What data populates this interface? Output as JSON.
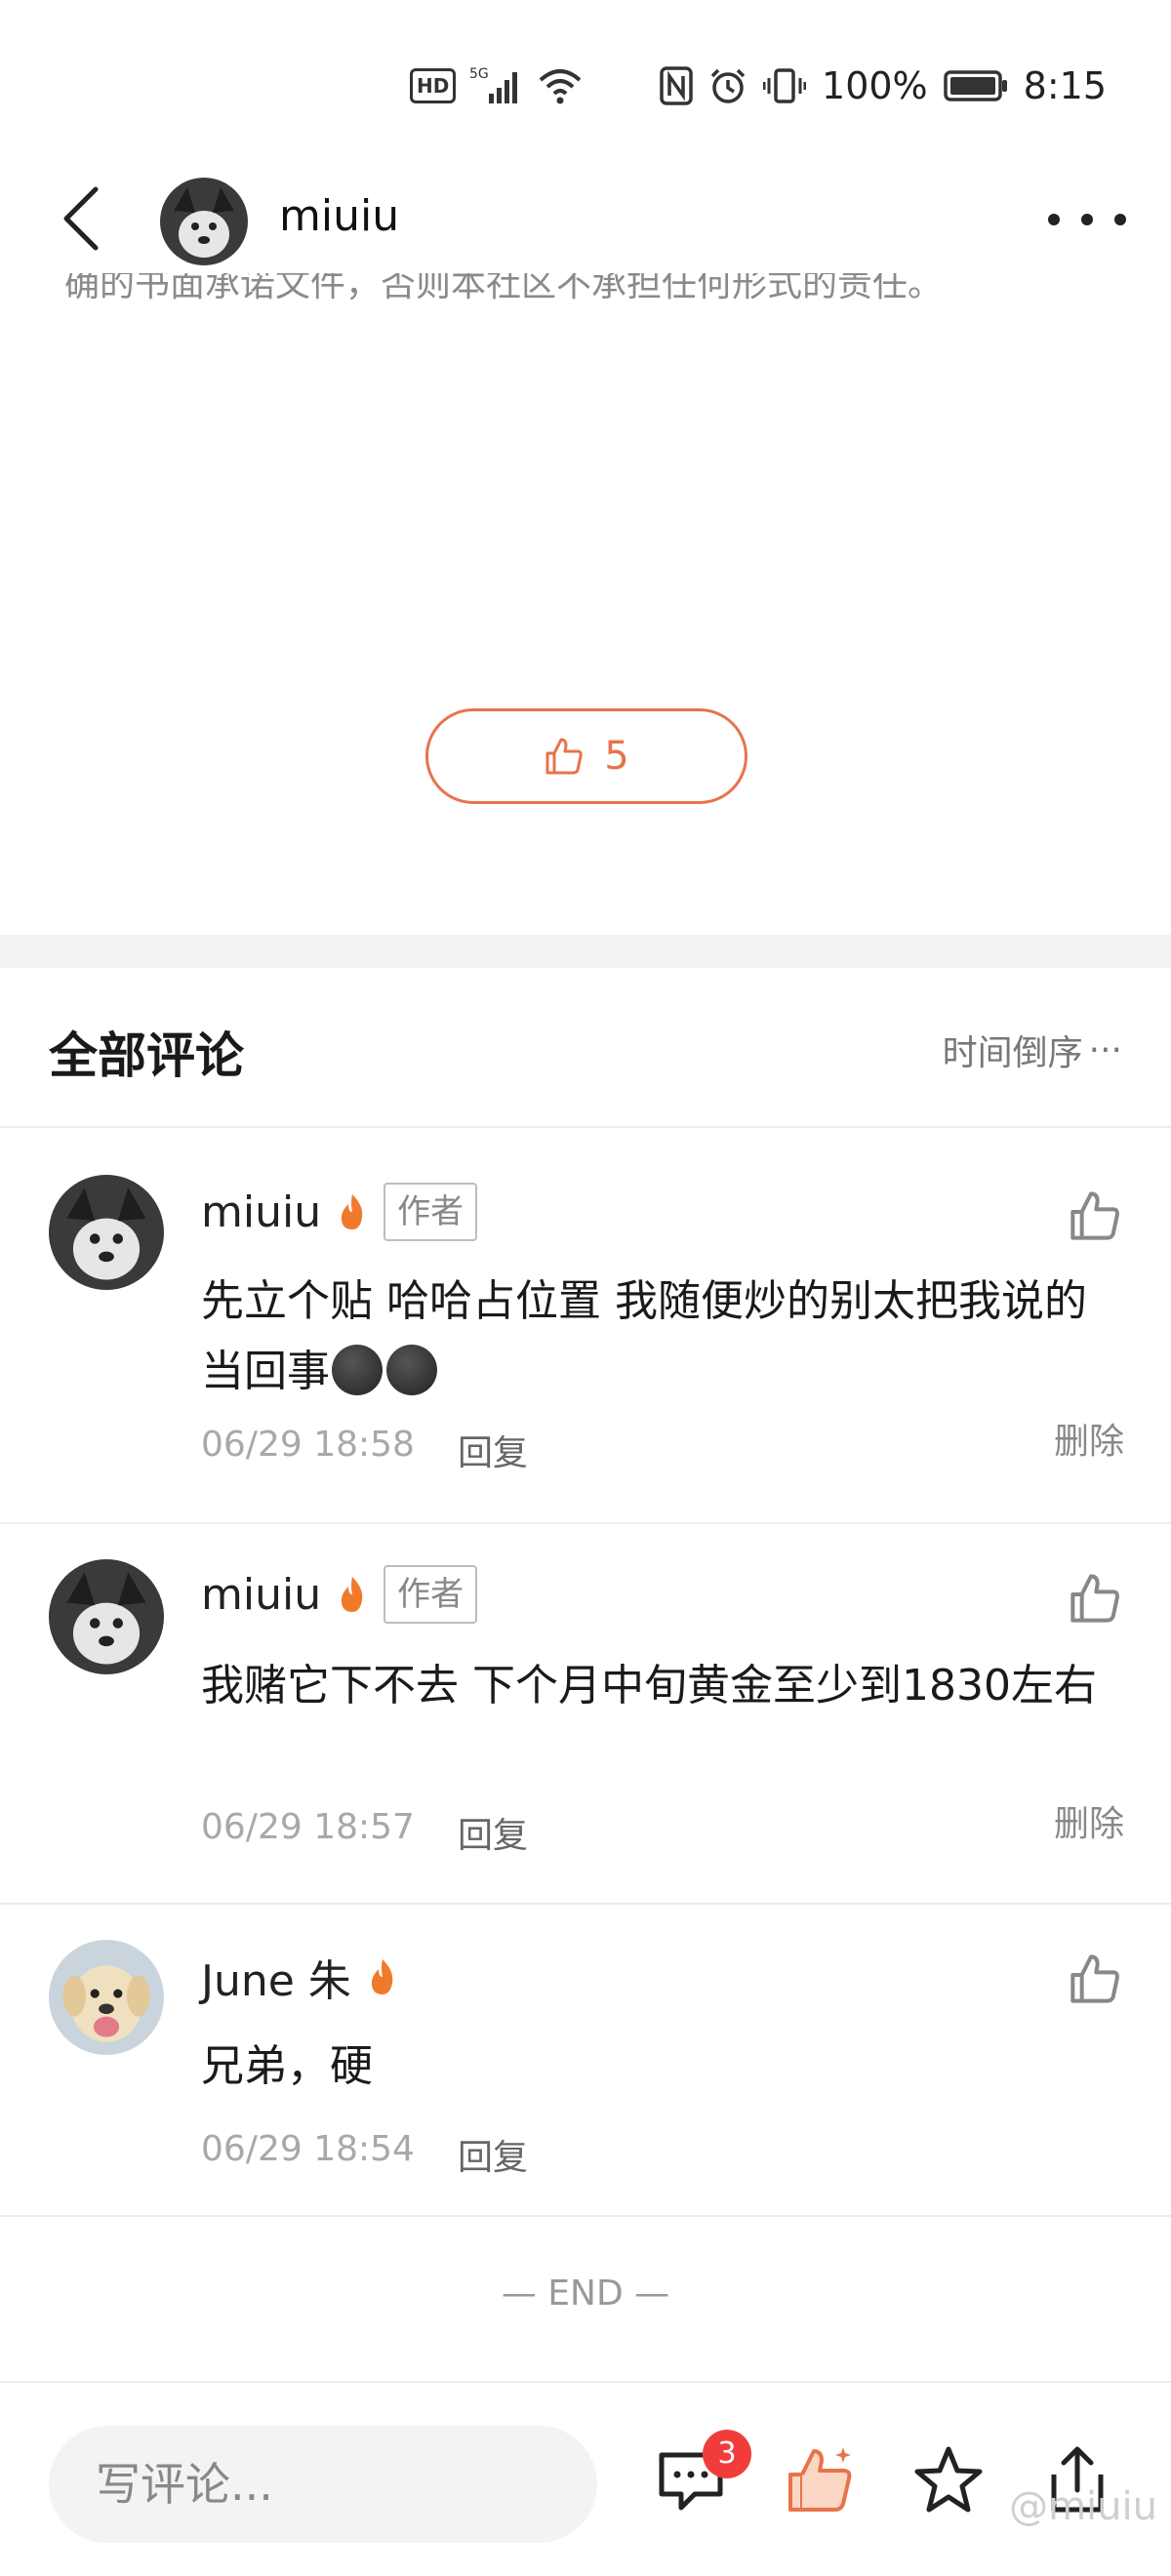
{
  "status_bar": {
    "hd_label": "HD",
    "network_label": "5G",
    "battery_percent": "100%",
    "time": "8:15",
    "icons": [
      "hd-icon",
      "signal-icon",
      "wifi-icon",
      "nfc-icon",
      "alarm-icon",
      "vibrate-icon",
      "battery-icon"
    ]
  },
  "header": {
    "username": "miuiu",
    "icons": [
      "back-icon",
      "avatar",
      "more-icon"
    ]
  },
  "post": {
    "disclaimer_partial": "确的书面承诺文件，否则本社区不承担任何形式的责任。",
    "like_count": "5"
  },
  "comments_section": {
    "title": "全部评论",
    "sort_label": "时间倒序",
    "sort_more": "···"
  },
  "comments": [
    {
      "username": "miuiu",
      "author_tag": "作者",
      "text": "先立个贴 哈哈占位置 我随便炒的别太把我说的当回事",
      "emoji_count": 2,
      "time": "06/29 18:58",
      "reply_label": "回复",
      "delete_label": "删除"
    },
    {
      "username": "miuiu",
      "author_tag": "作者",
      "text": "我赌它下不去 下个月中旬黄金至少到1830左右",
      "time": "06/29 18:57",
      "reply_label": "回复",
      "delete_label": "删除"
    },
    {
      "username": "June 朱",
      "text": "兄弟，硬",
      "time": "06/29 18:54",
      "reply_label": "回复"
    }
  ],
  "end_label": "— END —",
  "bottom_bar": {
    "input_placeholder": "写评论...",
    "comment_badge": "3",
    "watermark": "@miuiu",
    "icons": [
      "comment-icon",
      "like-icon",
      "star-icon",
      "share-icon"
    ]
  },
  "colors": {
    "accent": "#e8734a",
    "badge_red": "#f23c3c",
    "muted_text": "#a8a8a8"
  }
}
